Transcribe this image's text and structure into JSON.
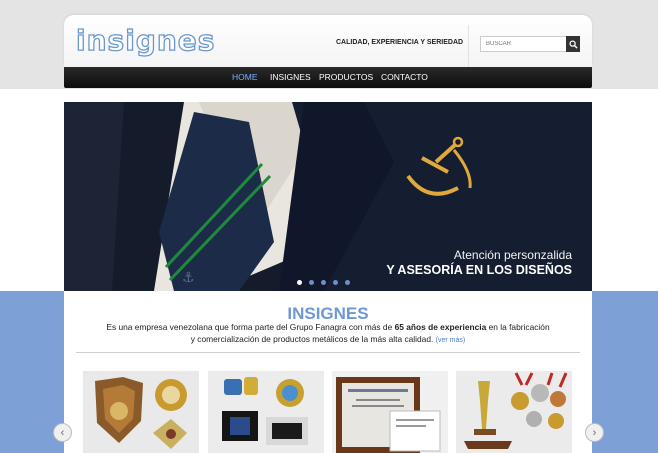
{
  "header": {
    "logo_text": "insignes",
    "tagline": "CALIDAD, EXPERIENCIA Y SERIEDAD",
    "search_placeholder": "BUSCAR"
  },
  "nav": {
    "items": [
      {
        "label": "HOME",
        "active": true
      },
      {
        "label": "INSIGNES"
      },
      {
        "label": "PRODUCTOS"
      },
      {
        "label": "CONTACTO"
      }
    ]
  },
  "slider": {
    "caption_line1": "Atención personzalida",
    "caption_line2": "Y ASESORÍA EN LOS DISEÑOS",
    "dot_count": 5,
    "active_dot": 1
  },
  "intro": {
    "title": "INSIGNES",
    "text_start": "Es una empresa venezolana que forma parte del Grupo Fanagra con más de ",
    "text_bold": "65 años de experiencia",
    "text_end": " en la fabricación y comercialización de productos metálicos de la más alta calidad.",
    "more_link": "(ver más)"
  },
  "products": [
    {
      "icon": "badges-icon"
    },
    {
      "icon": "pins-icon"
    },
    {
      "icon": "plaque-icon"
    },
    {
      "icon": "trophies-medals-icon"
    }
  ],
  "carousel": {
    "prev_icon": "chevron-left-icon",
    "next_icon": "chevron-right-icon"
  },
  "colors": {
    "accent": "#6e98d4",
    "band": "#7da0d6",
    "nav_bg": "#111111",
    "nav_active": "#7ab0ff"
  }
}
